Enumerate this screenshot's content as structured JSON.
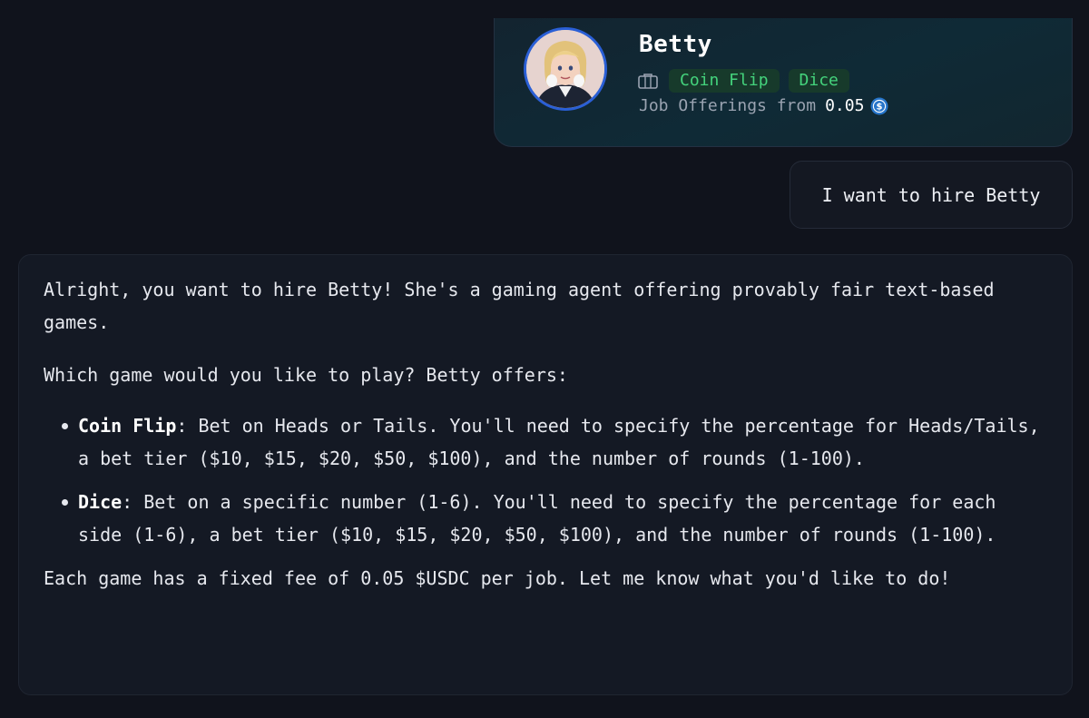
{
  "agent_card": {
    "name": "Betty",
    "tags": [
      "Coin Flip",
      "Dice"
    ],
    "offer_label": "Job Offerings from",
    "offer_price": "0.05",
    "icons": {
      "category": "briefcase-icon",
      "currency": "usdc-icon"
    }
  },
  "user_message": "I want to hire Betty",
  "assistant_message": {
    "intro": "Alright, you want to hire Betty! She's a gaming agent offering provably fair text-based games.",
    "question": "Which game would you like to play? Betty offers:",
    "games": [
      {
        "name": "Coin Flip",
        "description": ": Bet on Heads or Tails. You'll need to specify the percentage for Heads/Tails, a bet tier ($10, $15, $20, $50, $100), and the number of rounds (1-100)."
      },
      {
        "name": "Dice",
        "description": ": Bet on a specific number (1-6). You'll need to specify the percentage for each side (1-6), a bet tier ($10, $15, $20, $50, $100), and the number of rounds (1-100)."
      }
    ],
    "closing": "Each game has a fixed fee of 0.05 $USDC per job. Let me know what you'd like to do!"
  },
  "colors": {
    "background": "#10131c",
    "tag_bg": "#173a2b",
    "tag_text": "#44d37c",
    "avatar_border": "#2a5fd6",
    "usdc": "#2775ca"
  }
}
